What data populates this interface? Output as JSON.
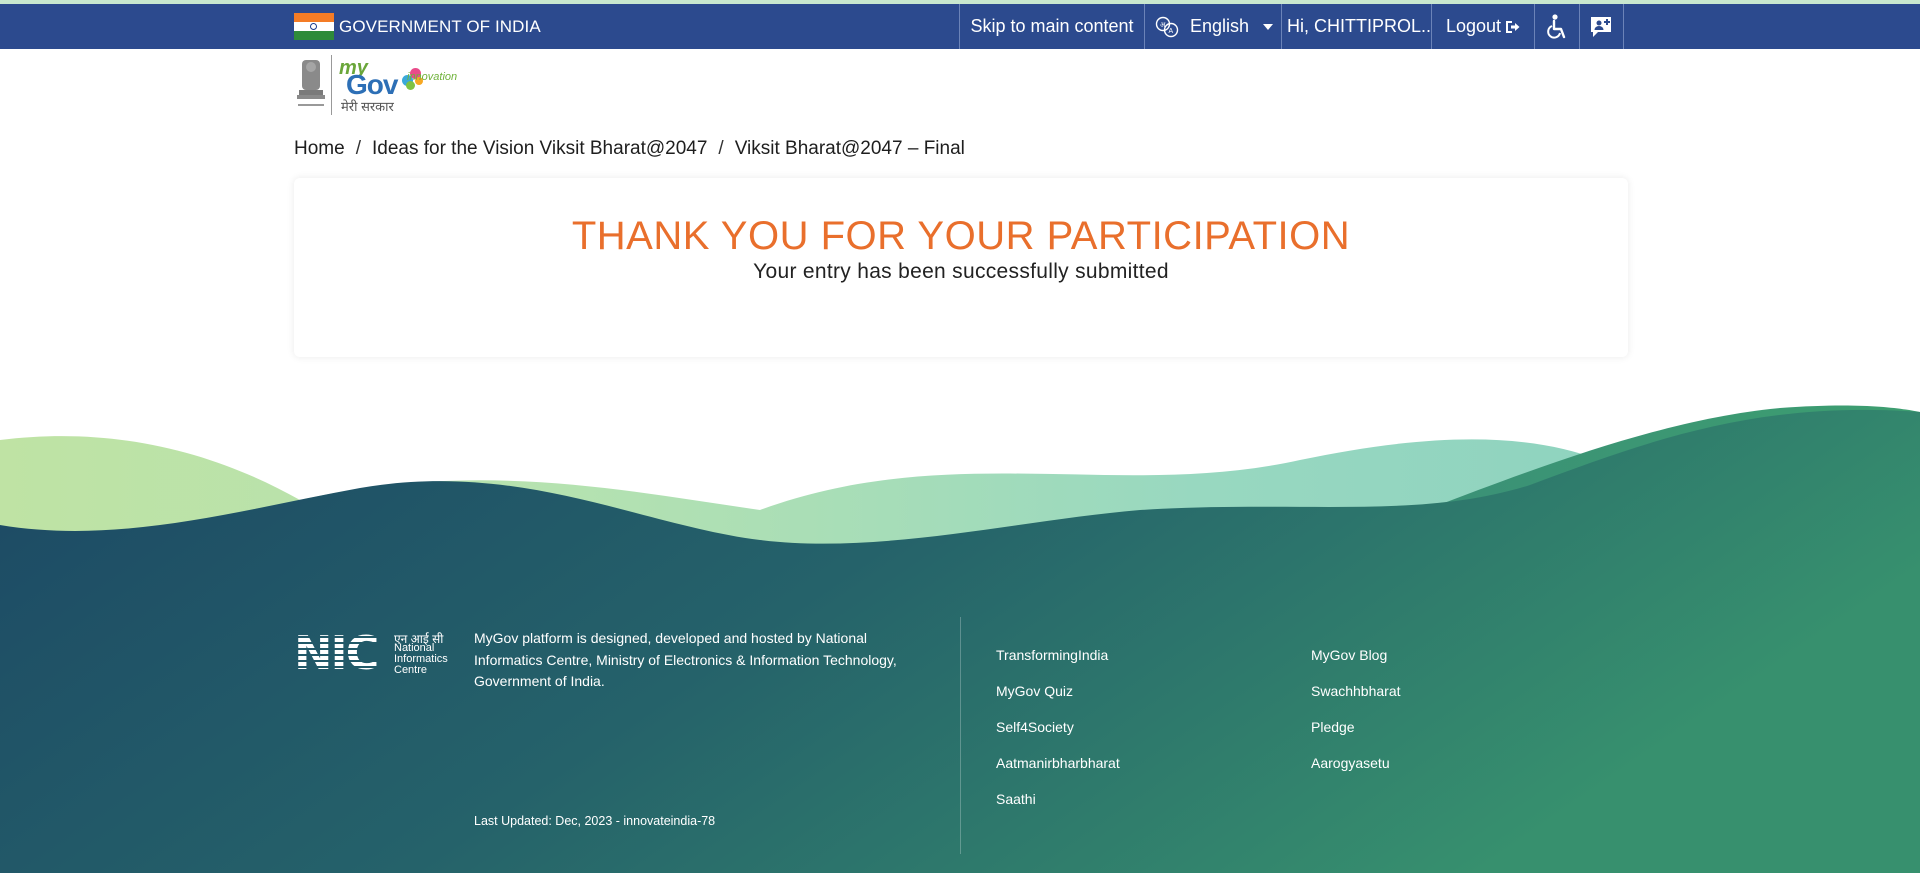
{
  "gov_bar": {
    "title": "GOVERNMENT OF INDIA",
    "skip_link": "Skip to main content",
    "language": "English",
    "user_greeting": "Hi, CHITTIPROL...",
    "logout": "Logout",
    "colors": {
      "bar": "#2c4a8e",
      "accent_line": "#c9e8cf"
    },
    "icons": [
      "india-flag-icon",
      "translate-icon",
      "chevron-down-icon",
      "logout-icon",
      "accessibility-icon",
      "feedback-icon"
    ]
  },
  "logo": {
    "my": "my",
    "gov": "Gov",
    "hindi": "मेरी सरकार",
    "innovation": "innovation"
  },
  "breadcrumb": {
    "items": [
      "Home",
      "Ideas for the Vision Viksit Bharat@2047",
      "Viksit Bharat@2047 – Final"
    ],
    "separator": "/"
  },
  "message": {
    "title": "THANK YOU FOR YOUR PARTICIPATION",
    "subtitle": "Your entry has been successfully submitted",
    "title_color": "#e96f2c"
  },
  "footer": {
    "nic_logo": "NIC",
    "nic_hindi": "एन आई सी",
    "nic_name": "National Informatics Centre",
    "about": "MyGov platform is designed, developed and hosted by National Informatics Centre, Ministry of Electronics & Information Technology, Government of India.",
    "last_updated": "Last Updated: Dec, 2023 - innovateindia-78",
    "links_col1": [
      "TransformingIndia",
      "MyGov Quiz",
      "Self4Society",
      "Aatmanirbharbharat",
      "Saathi"
    ],
    "links_col2": [
      "MyGov Blog",
      "Swachhbharat",
      "Pledge",
      "Aarogyasetu"
    ],
    "colors": {
      "dark": "#1d4a63",
      "green": "#3b9b6e",
      "light_wave": "#b9e2a8"
    }
  }
}
